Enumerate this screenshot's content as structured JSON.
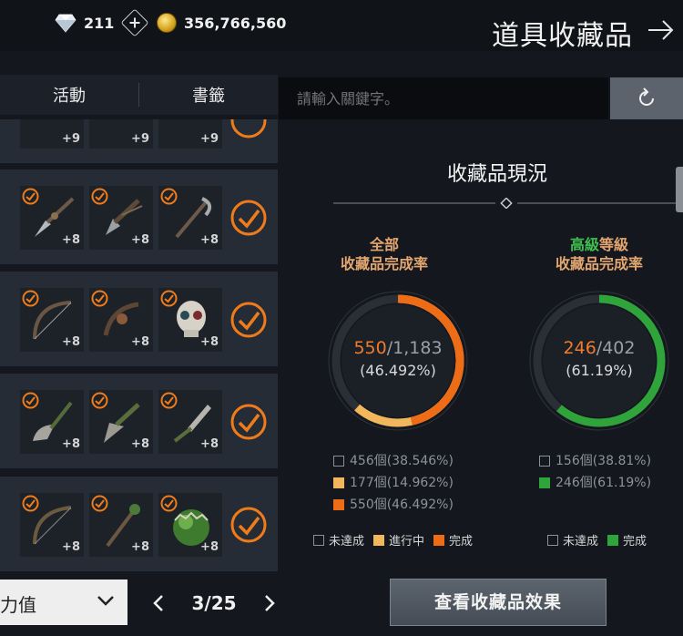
{
  "topbar": {
    "gems": "211",
    "gold": "356,766,560",
    "title": "道具收藏品"
  },
  "tabs": [
    {
      "label": "活動"
    },
    {
      "label": "書籤"
    }
  ],
  "search": {
    "placeholder": "請輸入關鍵字。"
  },
  "grid": {
    "partial_row": {
      "items": [
        {
          "level": "+9"
        },
        {
          "level": "+9"
        },
        {
          "level": "+9"
        }
      ]
    },
    "rows": [
      {
        "items": [
          {
            "level": "+8"
          },
          {
            "level": "+8"
          },
          {
            "level": "+8"
          }
        ]
      },
      {
        "items": [
          {
            "level": "+8"
          },
          {
            "level": "+8"
          },
          {
            "level": "+8"
          }
        ]
      },
      {
        "items": [
          {
            "level": "+8"
          },
          {
            "level": "+8"
          },
          {
            "level": "+8"
          }
        ]
      },
      {
        "items": [
          {
            "level": "+8"
          },
          {
            "level": "+8"
          },
          {
            "level": "+8"
          }
        ]
      }
    ]
  },
  "panel": {
    "title": "收藏品現況",
    "all": {
      "head_line1": "全部",
      "head_line2": "收藏品完成率",
      "completed": "550",
      "total": "/1,183",
      "percent": "(46.492%)",
      "fraction_done": 0.46492,
      "fraction_in_progress": 0.14962,
      "stats": [
        {
          "text": "456個(38.546%)"
        },
        {
          "text": "177個(14.962%)"
        },
        {
          "text": "550個(46.492%)"
        }
      ],
      "legend": {
        "not_done": "未達成",
        "in_progress": "進行中",
        "done": "完成"
      }
    },
    "advanced": {
      "head_green": "高級",
      "head_rest": "等級",
      "head_line2": "收藏品完成率",
      "completed": "246",
      "total": "/402",
      "percent": "(61.19%)",
      "fraction_done": 0.6119,
      "stats": [
        {
          "text": "156個(38.81%)"
        },
        {
          "text": "246個(61.19%)"
        }
      ],
      "legend": {
        "not_done": "未達成",
        "done": "完成"
      }
    }
  },
  "bottom": {
    "sort_label": "力值",
    "page": "3/25",
    "effect_button": "查看收藏品效果"
  },
  "colors": {
    "orange": "#ef6c16",
    "light_orange": "#f2b75d",
    "green": "#2fa43b",
    "ring_track": "#2a2f37"
  }
}
